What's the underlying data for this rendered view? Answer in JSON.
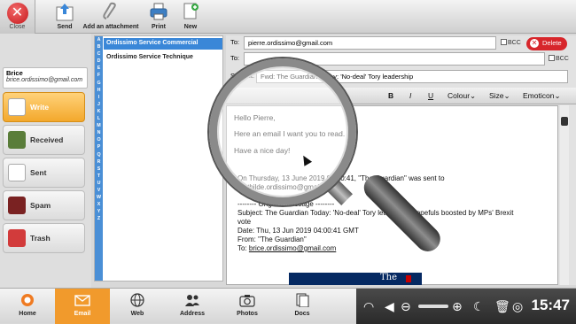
{
  "toolbar": {
    "close": "Close",
    "send": "Send",
    "attach": "Add an attachment",
    "print": "Print",
    "new": "New"
  },
  "user": {
    "name": "Brice",
    "email": "brice.ordissimo@gmail.com"
  },
  "folders": [
    {
      "label": "Write"
    },
    {
      "label": "Received"
    },
    {
      "label": "Sent"
    },
    {
      "label": "Spam"
    },
    {
      "label": "Trash"
    }
  ],
  "alphabet": [
    "A",
    "B",
    "C",
    "D",
    "E",
    "F",
    "G",
    "H",
    "I",
    "J",
    "K",
    "L",
    "M",
    "N",
    "O",
    "P",
    "Q",
    "R",
    "S",
    "T",
    "U",
    "V",
    "W",
    "X",
    "Y",
    "Z"
  ],
  "contacts": [
    {
      "name": "Ordissimo Service Commercial"
    },
    {
      "name": "Ordissimo Service Technique"
    }
  ],
  "compose": {
    "to_label": "To:",
    "to_value": "pierre.ordissimo@gmail.com",
    "to2_label": "To:",
    "to2_value": "",
    "bcc": "BCC",
    "delete": "Delete",
    "subject_label": "Subject:",
    "subject_value": "Fwd: The Guardian Today: 'No-deal' Tory leadership"
  },
  "format": {
    "bold": "B",
    "italic": "I",
    "underline": "U",
    "colour": "Colour",
    "size": "Size",
    "emoticon": "Emoticon"
  },
  "body": {
    "greeting": "Hello Pierre,",
    "line1": "Here an email I want you to read.",
    "line2": "Have a nice day!",
    "fwd_intro": "On Thursday, 13 June 2019 04:00:41, \"The Guardian\" was sent to",
    "fwd_intro2": "mathilde.ordissimo@gmail.com",
    "orig": "-------- Original message --------",
    "orig_subject": "Subject: The Guardian Today: 'No-deal' Tory leadership hopefuls boosted by MPs' Brexit",
    "orig_subject2": "vote",
    "orig_date": "Date: Thu, 13 Jun 2019 04:00:41 GMT",
    "orig_from": "From: \"The Guardian\"",
    "orig_to_label": "To: ",
    "orig_to": "brice.ordissimo@gmail.com",
    "banner": "The"
  },
  "taskbar": [
    {
      "label": "Home"
    },
    {
      "label": "Email"
    },
    {
      "label": "Web"
    },
    {
      "label": "Address"
    },
    {
      "label": "Photos"
    },
    {
      "label": "Docs"
    }
  ],
  "clock": "15:47",
  "colors": {
    "accent_orange": "#f19a2c",
    "delete_red": "#d7262b",
    "selection_blue": "#3a87d8",
    "alpha_blue": "#4a8fd6"
  }
}
